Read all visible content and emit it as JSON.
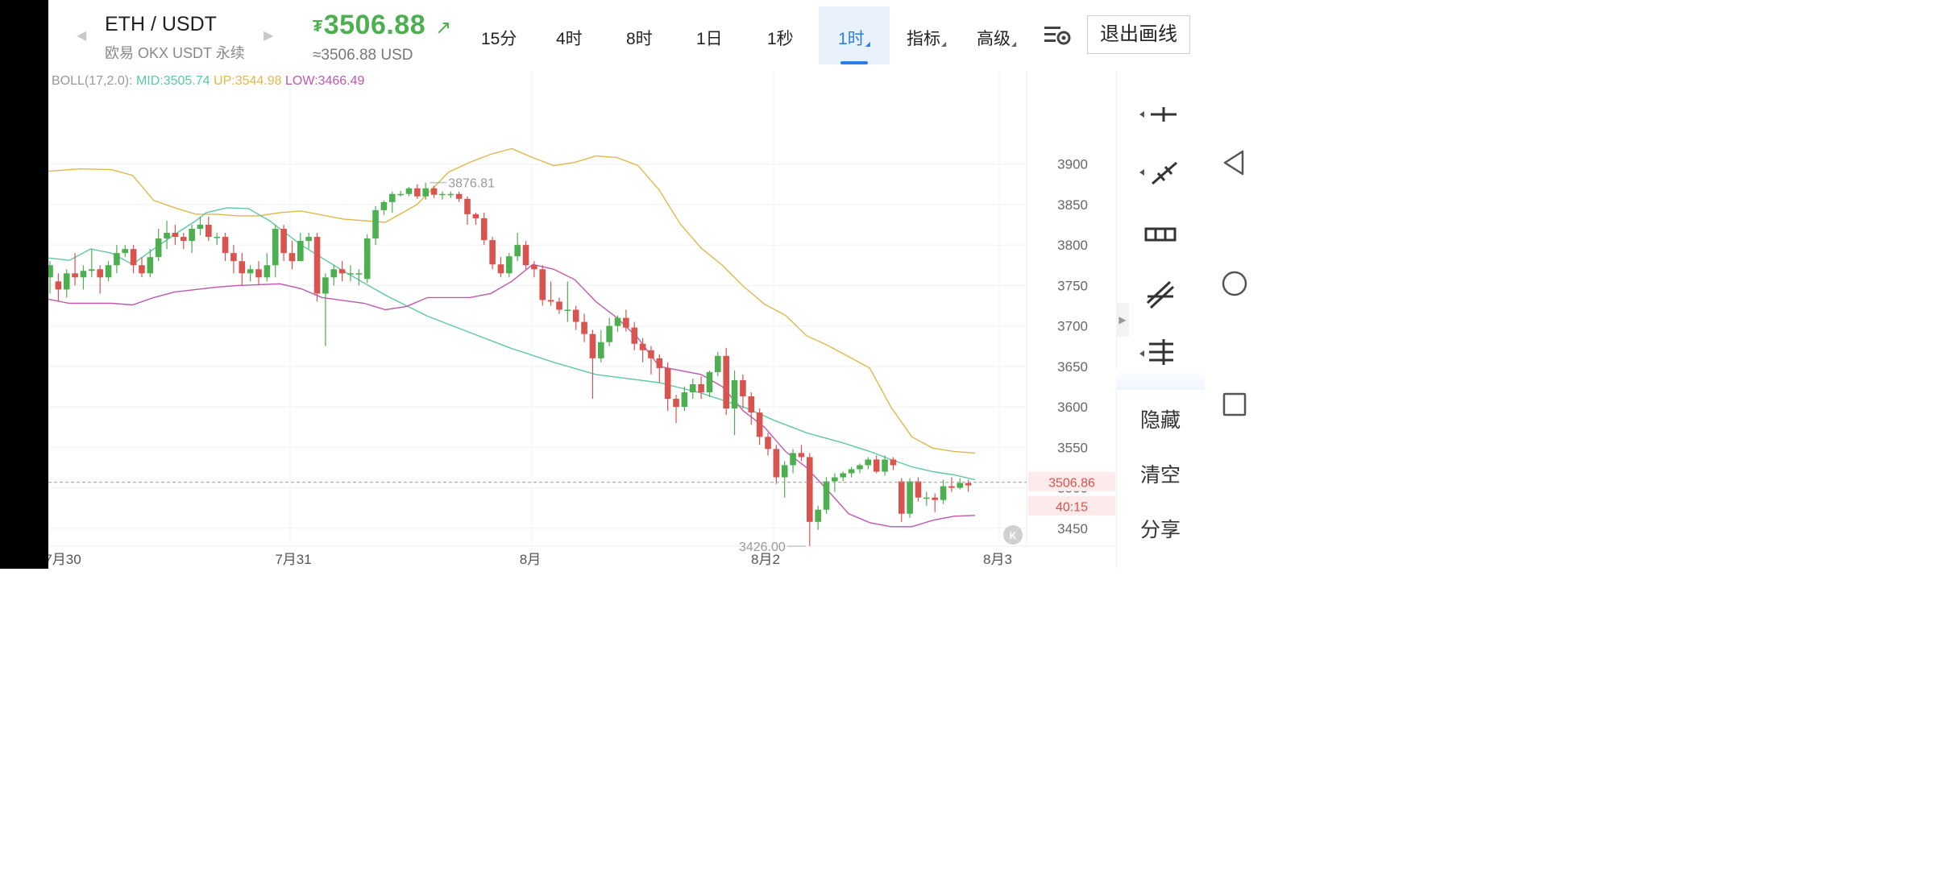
{
  "header": {
    "pair": "ETH / USDT",
    "exchange": "欧易 OKX USDT 永续",
    "currency_symbol": "₮",
    "price": "3506.88",
    "usd_equivalent": "≈3506.88 USD",
    "price_color": "#4caf50"
  },
  "timeframes": [
    {
      "label": "15分",
      "active": false
    },
    {
      "label": "4时",
      "active": false
    },
    {
      "label": "8时",
      "active": false
    },
    {
      "label": "1日",
      "active": false
    },
    {
      "label": "1秒",
      "active": false
    },
    {
      "label": "1时",
      "active": true
    },
    {
      "label": "指标",
      "active": false
    },
    {
      "label": "高级",
      "active": false
    }
  ],
  "exit_button": "退出画线",
  "indicator": {
    "name": "BOLL(17,2.0):",
    "mid": "MID:3505.74",
    "up": "UP:3544.98",
    "low": "LOW:3466.49"
  },
  "right_panel": {
    "tools": [
      "horizontal-line-icon",
      "ray-line-icon",
      "price-range-icon",
      "parallel-channel-icon",
      "fib-lines-icon"
    ],
    "hide": "隐藏",
    "clear": "清空",
    "share": "分享"
  },
  "system_nav": [
    "back-icon",
    "home-icon",
    "recent-apps-icon"
  ],
  "chart_data": {
    "type": "candlestick",
    "interval": "1时",
    "ylim": [
      3420,
      3940
    ],
    "y_ticks": [
      "3900",
      "3850",
      "3800",
      "3750",
      "3700",
      "3650",
      "3600",
      "3550",
      "3500",
      "3450"
    ],
    "x_labels": [
      "7月30",
      "7月31",
      "8月",
      "8月2",
      "8月3"
    ],
    "current_price_tag": "3506.86",
    "countdown_tag": "40:15",
    "high_marker": "3876.81",
    "low_marker": "3426.00",
    "colors": {
      "up": "#4caf50",
      "down": "#d9534f",
      "mid": "#5cc8a4",
      "upper": "#e0b84a",
      "lower": "#c056b0"
    },
    "candles": [
      [
        3760,
        3775,
        3740,
        3780
      ],
      [
        3755,
        3745,
        3730,
        3765
      ],
      [
        3745,
        3765,
        3735,
        3770
      ],
      [
        3765,
        3760,
        3750,
        3790
      ],
      [
        3760,
        3768,
        3745,
        3775
      ],
      [
        3768,
        3770,
        3760,
        3795
      ],
      [
        3770,
        3760,
        3740,
        3775
      ],
      [
        3760,
        3775,
        3755,
        3780
      ],
      [
        3775,
        3790,
        3765,
        3800
      ],
      [
        3790,
        3795,
        3785,
        3800
      ],
      [
        3795,
        3775,
        3765,
        3800
      ],
      [
        3775,
        3765,
        3760,
        3785
      ],
      [
        3765,
        3785,
        3760,
        3795
      ],
      [
        3785,
        3808,
        3780,
        3820
      ],
      [
        3808,
        3815,
        3795,
        3830
      ],
      [
        3815,
        3810,
        3800,
        3825
      ],
      [
        3810,
        3805,
        3795,
        3815
      ],
      [
        3805,
        3820,
        3790,
        3825
      ],
      [
        3820,
        3825,
        3812,
        3835
      ],
      [
        3825,
        3810,
        3805,
        3835
      ],
      [
        3810,
        3810,
        3800,
        3815
      ],
      [
        3810,
        3790,
        3780,
        3815
      ],
      [
        3790,
        3780,
        3765,
        3800
      ],
      [
        3780,
        3765,
        3750,
        3790
      ],
      [
        3765,
        3770,
        3755,
        3775
      ],
      [
        3770,
        3760,
        3750,
        3780
      ],
      [
        3760,
        3775,
        3755,
        3790
      ],
      [
        3775,
        3820,
        3760,
        3825
      ],
      [
        3820,
        3790,
        3780,
        3825
      ],
      [
        3790,
        3780,
        3770,
        3805
      ],
      [
        3780,
        3805,
        3790,
        3815
      ],
      [
        3805,
        3810,
        3795,
        3815
      ],
      [
        3810,
        3740,
        3730,
        3815
      ],
      [
        3740,
        3760,
        3675,
        3765
      ],
      [
        3760,
        3770,
        3750,
        3775
      ],
      [
        3770,
        3765,
        3755,
        3780
      ],
      [
        3765,
        3765,
        3755,
        3775
      ],
      [
        3765,
        3765,
        3750,
        3770
      ],
      [
        3758,
        3808,
        3753,
        3813
      ],
      [
        3808,
        3843,
        3800,
        3848
      ],
      [
        3843,
        3853,
        3837,
        3855
      ],
      [
        3853,
        3863,
        3840,
        3866
      ],
      [
        3863,
        3863,
        3860,
        3867
      ],
      [
        3863,
        3870,
        3860,
        3872
      ],
      [
        3870,
        3860,
        3857,
        3875
      ],
      [
        3860,
        3870,
        3856,
        3877
      ],
      [
        3870,
        3862,
        3858,
        3873
      ],
      [
        3862,
        3863,
        3856,
        3866
      ],
      [
        3863,
        3863,
        3858,
        3866
      ],
      [
        3863,
        3857,
        3853,
        3866
      ],
      [
        3857,
        3838,
        3825,
        3860
      ],
      [
        3838,
        3833,
        3825,
        3840
      ],
      [
        3833,
        3806,
        3800,
        3840
      ],
      [
        3806,
        3776,
        3770,
        3810
      ],
      [
        3776,
        3765,
        3760,
        3785
      ],
      [
        3765,
        3786,
        3760,
        3790
      ],
      [
        3786,
        3800,
        3780,
        3815
      ],
      [
        3800,
        3775,
        3770,
        3805
      ],
      [
        3775,
        3770,
        3760,
        3780
      ],
      [
        3770,
        3732,
        3725,
        3775
      ],
      [
        3732,
        3730,
        3725,
        3755
      ],
      [
        3730,
        3720,
        3715,
        3735
      ],
      [
        3720,
        3720,
        3705,
        3755
      ],
      [
        3720,
        3705,
        3695,
        3725
      ],
      [
        3705,
        3690,
        3680,
        3715
      ],
      [
        3690,
        3660,
        3610,
        3695
      ],
      [
        3660,
        3680,
        3655,
        3695
      ],
      [
        3680,
        3700,
        3675,
        3710
      ],
      [
        3700,
        3710,
        3693,
        3713
      ],
      [
        3710,
        3698,
        3693,
        3720
      ],
      [
        3698,
        3678,
        3670,
        3705
      ],
      [
        3678,
        3670,
        3655,
        3685
      ],
      [
        3670,
        3660,
        3640,
        3675
      ],
      [
        3660,
        3648,
        3630,
        3665
      ],
      [
        3648,
        3610,
        3595,
        3655
      ],
      [
        3610,
        3600,
        3580,
        3615
      ],
      [
        3600,
        3618,
        3595,
        3625
      ],
      [
        3618,
        3628,
        3610,
        3635
      ],
      [
        3628,
        3618,
        3610,
        3638
      ],
      [
        3618,
        3643,
        3612,
        3645
      ],
      [
        3643,
        3663,
        3638,
        3668
      ],
      [
        3663,
        3598,
        3590,
        3673
      ],
      [
        3598,
        3633,
        3565,
        3645
      ],
      [
        3633,
        3613,
        3598,
        3640
      ],
      [
        3613,
        3593,
        3578,
        3618
      ],
      [
        3593,
        3563,
        3553,
        3598
      ],
      [
        3563,
        3548,
        3540,
        3568
      ],
      [
        3548,
        3513,
        3505,
        3553
      ],
      [
        3513,
        3528,
        3488,
        3533
      ],
      [
        3528,
        3543,
        3518,
        3548
      ],
      [
        3543,
        3538,
        3533,
        3553
      ],
      [
        3538,
        3458,
        3428,
        3543
      ],
      [
        3458,
        3473,
        3448,
        3478
      ],
      [
        3473,
        3508,
        3468,
        3513
      ],
      [
        3508,
        3513,
        3495,
        3518
      ],
      [
        3513,
        3518,
        3508,
        3520
      ],
      [
        3518,
        3523,
        3513,
        3526
      ],
      [
        3523,
        3528,
        3518,
        3530
      ],
      [
        3528,
        3535,
        3523,
        3538
      ],
      [
        3535,
        3520,
        3518,
        3540
      ],
      [
        3520,
        3535,
        3515,
        3540
      ],
      [
        3535,
        3528,
        3522,
        3538
      ],
      [
        3508,
        3468,
        3458,
        3512
      ],
      [
        3468,
        3508,
        3463,
        3512
      ],
      [
        3508,
        3488,
        3483,
        3513
      ],
      [
        3488,
        3488,
        3478,
        3495
      ],
      [
        3488,
        3485,
        3470,
        3493
      ],
      [
        3485,
        3502,
        3480,
        3510
      ],
      [
        3502,
        3500,
        3495,
        3513
      ],
      [
        3500,
        3506,
        3498,
        3512
      ],
      [
        3506,
        3503,
        3495,
        3510
      ]
    ],
    "mid_band": [
      [
        0,
        3784
      ],
      [
        10,
        3781
      ],
      [
        20,
        3795
      ],
      [
        30,
        3790
      ],
      [
        40,
        3776
      ],
      [
        50,
        3795
      ],
      [
        60,
        3813
      ],
      [
        70,
        3830
      ],
      [
        75,
        3840
      ],
      [
        85,
        3846
      ],
      [
        95,
        3845
      ],
      [
        105,
        3830
      ],
      [
        120,
        3800
      ],
      [
        140,
        3768
      ],
      [
        160,
        3738
      ],
      [
        180,
        3712
      ],
      [
        200,
        3692
      ],
      [
        220,
        3672
      ],
      [
        240,
        3655
      ],
      [
        260,
        3640
      ],
      [
        290,
        3630
      ],
      [
        310,
        3617
      ],
      [
        330,
        3600
      ],
      [
        345,
        3583
      ],
      [
        360,
        3568
      ],
      [
        378,
        3555
      ],
      [
        390,
        3545
      ],
      [
        400,
        3535
      ],
      [
        410,
        3526
      ],
      [
        420,
        3520
      ],
      [
        430,
        3516
      ],
      [
        440,
        3510
      ]
    ],
    "upper_band": [
      [
        0,
        3891
      ],
      [
        15,
        3894
      ],
      [
        30,
        3893
      ],
      [
        40,
        3886
      ],
      [
        50,
        3855
      ],
      [
        60,
        3846
      ],
      [
        70,
        3838
      ],
      [
        80,
        3838
      ],
      [
        90,
        3836
      ],
      [
        100,
        3836
      ],
      [
        110,
        3840
      ],
      [
        120,
        3842
      ],
      [
        130,
        3837
      ],
      [
        140,
        3832
      ],
      [
        160,
        3828
      ],
      [
        175,
        3850
      ],
      [
        190,
        3890
      ],
      [
        200,
        3902
      ],
      [
        210,
        3912
      ],
      [
        220,
        3919
      ],
      [
        230,
        3908
      ],
      [
        240,
        3898
      ],
      [
        250,
        3902
      ],
      [
        260,
        3910
      ],
      [
        270,
        3908
      ],
      [
        280,
        3898
      ],
      [
        290,
        3868
      ],
      [
        300,
        3826
      ],
      [
        310,
        3796
      ],
      [
        320,
        3775
      ],
      [
        330,
        3749
      ],
      [
        340,
        3727
      ],
      [
        350,
        3713
      ],
      [
        360,
        3688
      ],
      [
        370,
        3676
      ],
      [
        380,
        3662
      ],
      [
        390,
        3648
      ],
      [
        400,
        3600
      ],
      [
        410,
        3563
      ],
      [
        420,
        3549
      ],
      [
        430,
        3545
      ],
      [
        440,
        3543
      ]
    ],
    "lower_band": [
      [
        0,
        3733
      ],
      [
        10,
        3728
      ],
      [
        30,
        3728
      ],
      [
        40,
        3726
      ],
      [
        50,
        3735
      ],
      [
        60,
        3742
      ],
      [
        80,
        3748
      ],
      [
        90,
        3750
      ],
      [
        110,
        3752
      ],
      [
        120,
        3746
      ],
      [
        130,
        3735
      ],
      [
        150,
        3728
      ],
      [
        160,
        3720
      ],
      [
        170,
        3724
      ],
      [
        180,
        3735
      ],
      [
        190,
        3735
      ],
      [
        200,
        3735
      ],
      [
        210,
        3740
      ],
      [
        220,
        3755
      ],
      [
        230,
        3776
      ],
      [
        240,
        3770
      ],
      [
        250,
        3757
      ],
      [
        260,
        3730
      ],
      [
        270,
        3710
      ],
      [
        280,
        3685
      ],
      [
        290,
        3650
      ],
      [
        300,
        3645
      ],
      [
        310,
        3640
      ],
      [
        320,
        3625
      ],
      [
        330,
        3595
      ],
      [
        340,
        3575
      ],
      [
        350,
        3545
      ],
      [
        360,
        3525
      ],
      [
        370,
        3497
      ],
      [
        380,
        3468
      ],
      [
        390,
        3457
      ],
      [
        400,
        3452
      ],
      [
        410,
        3452
      ],
      [
        420,
        3460
      ],
      [
        430,
        3465
      ],
      [
        440,
        3466
      ]
    ]
  }
}
